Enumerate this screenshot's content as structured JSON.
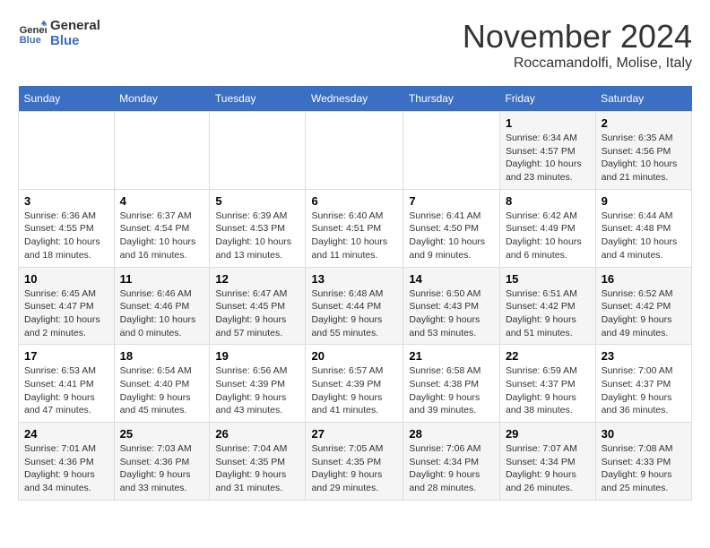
{
  "logo": {
    "line1": "General",
    "line2": "Blue"
  },
  "title": "November 2024",
  "location": "Roccamandolfi, Molise, Italy",
  "days_of_week": [
    "Sunday",
    "Monday",
    "Tuesday",
    "Wednesday",
    "Thursday",
    "Friday",
    "Saturday"
  ],
  "weeks": [
    [
      {
        "day": "",
        "info": ""
      },
      {
        "day": "",
        "info": ""
      },
      {
        "day": "",
        "info": ""
      },
      {
        "day": "",
        "info": ""
      },
      {
        "day": "",
        "info": ""
      },
      {
        "day": "1",
        "info": "Sunrise: 6:34 AM\nSunset: 4:57 PM\nDaylight: 10 hours and 23 minutes."
      },
      {
        "day": "2",
        "info": "Sunrise: 6:35 AM\nSunset: 4:56 PM\nDaylight: 10 hours and 21 minutes."
      }
    ],
    [
      {
        "day": "3",
        "info": "Sunrise: 6:36 AM\nSunset: 4:55 PM\nDaylight: 10 hours and 18 minutes."
      },
      {
        "day": "4",
        "info": "Sunrise: 6:37 AM\nSunset: 4:54 PM\nDaylight: 10 hours and 16 minutes."
      },
      {
        "day": "5",
        "info": "Sunrise: 6:39 AM\nSunset: 4:53 PM\nDaylight: 10 hours and 13 minutes."
      },
      {
        "day": "6",
        "info": "Sunrise: 6:40 AM\nSunset: 4:51 PM\nDaylight: 10 hours and 11 minutes."
      },
      {
        "day": "7",
        "info": "Sunrise: 6:41 AM\nSunset: 4:50 PM\nDaylight: 10 hours and 9 minutes."
      },
      {
        "day": "8",
        "info": "Sunrise: 6:42 AM\nSunset: 4:49 PM\nDaylight: 10 hours and 6 minutes."
      },
      {
        "day": "9",
        "info": "Sunrise: 6:44 AM\nSunset: 4:48 PM\nDaylight: 10 hours and 4 minutes."
      }
    ],
    [
      {
        "day": "10",
        "info": "Sunrise: 6:45 AM\nSunset: 4:47 PM\nDaylight: 10 hours and 2 minutes."
      },
      {
        "day": "11",
        "info": "Sunrise: 6:46 AM\nSunset: 4:46 PM\nDaylight: 10 hours and 0 minutes."
      },
      {
        "day": "12",
        "info": "Sunrise: 6:47 AM\nSunset: 4:45 PM\nDaylight: 9 hours and 57 minutes."
      },
      {
        "day": "13",
        "info": "Sunrise: 6:48 AM\nSunset: 4:44 PM\nDaylight: 9 hours and 55 minutes."
      },
      {
        "day": "14",
        "info": "Sunrise: 6:50 AM\nSunset: 4:43 PM\nDaylight: 9 hours and 53 minutes."
      },
      {
        "day": "15",
        "info": "Sunrise: 6:51 AM\nSunset: 4:42 PM\nDaylight: 9 hours and 51 minutes."
      },
      {
        "day": "16",
        "info": "Sunrise: 6:52 AM\nSunset: 4:42 PM\nDaylight: 9 hours and 49 minutes."
      }
    ],
    [
      {
        "day": "17",
        "info": "Sunrise: 6:53 AM\nSunset: 4:41 PM\nDaylight: 9 hours and 47 minutes."
      },
      {
        "day": "18",
        "info": "Sunrise: 6:54 AM\nSunset: 4:40 PM\nDaylight: 9 hours and 45 minutes."
      },
      {
        "day": "19",
        "info": "Sunrise: 6:56 AM\nSunset: 4:39 PM\nDaylight: 9 hours and 43 minutes."
      },
      {
        "day": "20",
        "info": "Sunrise: 6:57 AM\nSunset: 4:39 PM\nDaylight: 9 hours and 41 minutes."
      },
      {
        "day": "21",
        "info": "Sunrise: 6:58 AM\nSunset: 4:38 PM\nDaylight: 9 hours and 39 minutes."
      },
      {
        "day": "22",
        "info": "Sunrise: 6:59 AM\nSunset: 4:37 PM\nDaylight: 9 hours and 38 minutes."
      },
      {
        "day": "23",
        "info": "Sunrise: 7:00 AM\nSunset: 4:37 PM\nDaylight: 9 hours and 36 minutes."
      }
    ],
    [
      {
        "day": "24",
        "info": "Sunrise: 7:01 AM\nSunset: 4:36 PM\nDaylight: 9 hours and 34 minutes."
      },
      {
        "day": "25",
        "info": "Sunrise: 7:03 AM\nSunset: 4:36 PM\nDaylight: 9 hours and 33 minutes."
      },
      {
        "day": "26",
        "info": "Sunrise: 7:04 AM\nSunset: 4:35 PM\nDaylight: 9 hours and 31 minutes."
      },
      {
        "day": "27",
        "info": "Sunrise: 7:05 AM\nSunset: 4:35 PM\nDaylight: 9 hours and 29 minutes."
      },
      {
        "day": "28",
        "info": "Sunrise: 7:06 AM\nSunset: 4:34 PM\nDaylight: 9 hours and 28 minutes."
      },
      {
        "day": "29",
        "info": "Sunrise: 7:07 AM\nSunset: 4:34 PM\nDaylight: 9 hours and 26 minutes."
      },
      {
        "day": "30",
        "info": "Sunrise: 7:08 AM\nSunset: 4:33 PM\nDaylight: 9 hours and 25 minutes."
      }
    ]
  ]
}
